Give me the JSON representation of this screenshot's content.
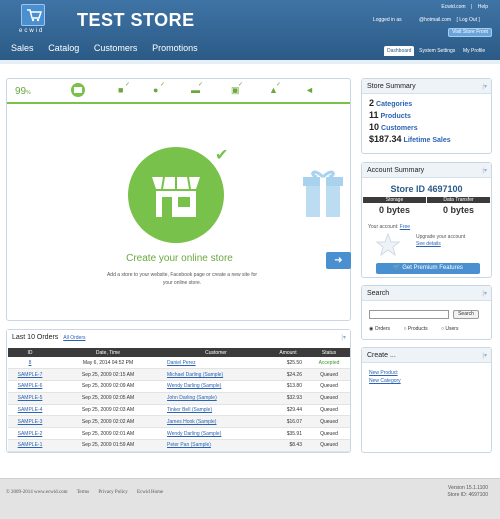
{
  "header": {
    "logo_text": "ecwid",
    "store_title": "TEST STORE",
    "top_links": [
      "Ecwid.com",
      "|",
      "Help"
    ],
    "logged_in_as": "Logged in as",
    "email": "@hotmail.com",
    "logout": "[ Log Out ]",
    "visit_store": "Visit Store Front",
    "main_nav": [
      "Sales",
      "Catalog",
      "Customers",
      "Promotions"
    ],
    "sub_nav": [
      "Dashboard",
      "System Settings",
      "My Profile"
    ]
  },
  "wizard": {
    "percent": "99",
    "percent_sign": "%",
    "title": "Create your online store",
    "description": "Add a store to your website, Facebook page or create a new site for your online store.",
    "next_icon": "arrow-right-icon"
  },
  "orders": {
    "title": "Last 10 Orders",
    "all_link": "All Orders",
    "columns": [
      "ID",
      "Date, Time",
      "Customer",
      "Amount",
      "Status"
    ],
    "rows": [
      {
        "id": "8",
        "date": "May 6, 2014 04:52 PM",
        "customer": "Daniel Perez",
        "amount": "$25.50",
        "status": "Accepted"
      },
      {
        "id": "SAMPLE-7",
        "date": "Sep 25, 2009 02:15 AM",
        "customer": "Michael Darling (Sample)",
        "amount": "$24.26",
        "status": "Queued"
      },
      {
        "id": "SAMPLE-6",
        "date": "Sep 25, 2009 02:09 AM",
        "customer": "Wendy Darling (Sample)",
        "amount": "$13.80",
        "status": "Queued"
      },
      {
        "id": "SAMPLE-5",
        "date": "Sep 25, 2009 02:05 AM",
        "customer": "John Darling (Sample)",
        "amount": "$32.93",
        "status": "Queued"
      },
      {
        "id": "SAMPLE-4",
        "date": "Sep 25, 2009 02:03 AM",
        "customer": "Tinker Bell (Sample)",
        "amount": "$29.44",
        "status": "Queued"
      },
      {
        "id": "SAMPLE-3",
        "date": "Sep 25, 2009 02:02 AM",
        "customer": "James Hook (Sample)",
        "amount": "$16.07",
        "status": "Queued"
      },
      {
        "id": "SAMPLE-2",
        "date": "Sep 25, 2009 02:01 AM",
        "customer": "Wendy Darling (Sample)",
        "amount": "$35.91",
        "status": "Queued"
      },
      {
        "id": "SAMPLE-1",
        "date": "Sep 25, 2009 01:59 AM",
        "customer": "Peter Pan (Sample)",
        "amount": "$8.43",
        "status": "Queued"
      }
    ]
  },
  "summary": {
    "title": "Store Summary",
    "items": [
      {
        "num": "2",
        "label": "Categories"
      },
      {
        "num": "11",
        "label": "Products"
      },
      {
        "num": "10",
        "label": "Customers"
      },
      {
        "num": "$187.34",
        "label": "Lifetime Sales"
      }
    ]
  },
  "account": {
    "title": "Account Summary",
    "store_id": "Store ID 4697100",
    "storage_label": "Storage",
    "storage_value": "0 bytes",
    "transfer_label": "Data Transfer",
    "transfer_value": "0 bytes",
    "account_label": "Your account:",
    "account_type": "Free",
    "upgrade_text": "Upgrade your account",
    "see_details": "See details",
    "premium_button": "Get Premium Features"
  },
  "search": {
    "title": "Search",
    "button": "Search",
    "options": [
      "Orders",
      "Products",
      "Users"
    ]
  },
  "create": {
    "title": "Create ...",
    "links": [
      "New Product",
      "New Category"
    ]
  },
  "footer": {
    "links": [
      "© 2009-2014 www.ecwid.com",
      "Terms",
      "Privacy Policy",
      "Ecwid Home"
    ],
    "version": "Version 15.1.1100",
    "store_id": "Store ID: 4697100"
  },
  "colors": {
    "header": "#2b5a86",
    "accent_green": "#78c14a",
    "link": "#2a63b5"
  },
  "options_label": "|▾"
}
